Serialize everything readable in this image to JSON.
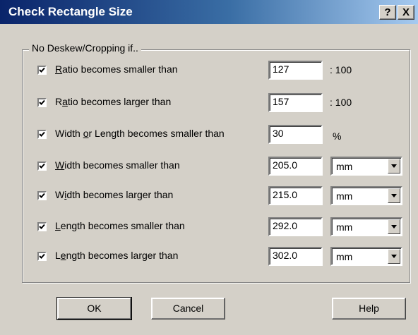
{
  "window": {
    "title": "Check Rectangle Size",
    "help_label": "?",
    "close_label": "X"
  },
  "group": {
    "label": "No Deskew/Cropping if.."
  },
  "rows": [
    {
      "pre": "",
      "acc": "R",
      "post": "atio becomes smaller than",
      "value": "127",
      "suffix": ": 100",
      "checked": true
    },
    {
      "pre": "",
      "acc": "a",
      "post": "tio becomes larger than",
      "value": "157",
      "suffix": ": 100",
      "checked": true
    },
    {
      "pre": "Width ",
      "acc": "o",
      "post": "r Length becomes smaller than",
      "value": "30",
      "suffix": "%",
      "checked": true
    },
    {
      "pre": "",
      "acc": "W",
      "post": "idth becomes smaller than",
      "value": "205.0",
      "unit": "mm",
      "checked": true
    },
    {
      "pre": "W",
      "acc": "i",
      "post": "dth becomes larger than",
      "value": "215.0",
      "unit": "mm",
      "checked": true
    },
    {
      "pre": "",
      "acc": "L",
      "post": "ength becomes smaller than",
      "value": "292.0",
      "unit": "mm",
      "checked": true
    },
    {
      "pre": "L",
      "acc": "e",
      "post": "ngth becomes larger than",
      "value": "302.0",
      "unit": "mm",
      "checked": true
    }
  ],
  "buttons": {
    "ok": "OK",
    "cancel": "Cancel",
    "help": "Help"
  },
  "colors": {
    "title_start": "#0a246a",
    "title_end": "#a6caf0",
    "face": "#d4d0c8"
  }
}
